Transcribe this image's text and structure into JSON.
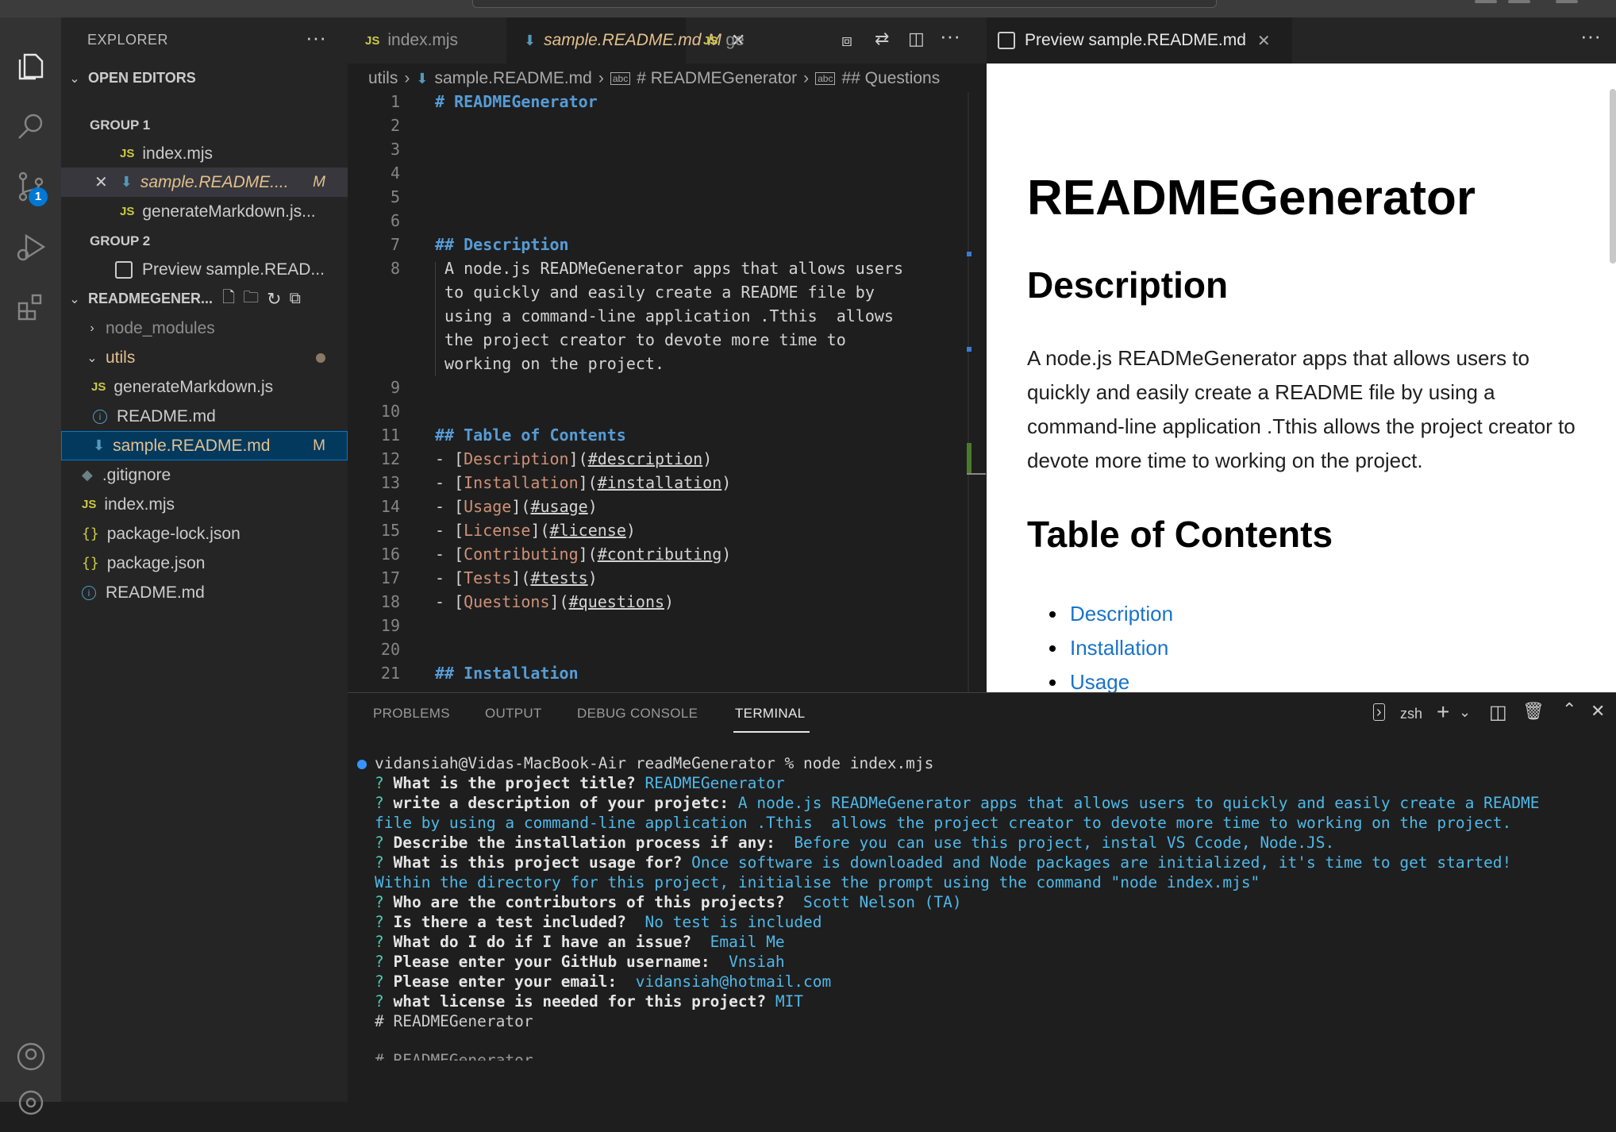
{
  "sidebar": {
    "title": "EXPLORER",
    "open_editors": "OPEN EDITORS",
    "group1": "GROUP 1",
    "group2": "GROUP 2",
    "oe_items": [
      "index.mjs",
      "sample.README....",
      "generateMarkdown.js...",
      "Preview sample.READ..."
    ],
    "mflag": "M",
    "project": "READMEGENER...",
    "tree": [
      "node_modules",
      "utils",
      "generateMarkdown.js",
      "README.md",
      "sample.README.md",
      ".gitignore",
      "index.mjs",
      "package-lock.json",
      "package.json",
      "README.md"
    ],
    "scm_badge": "1"
  },
  "editor": {
    "tabs": [
      "index.mjs",
      "sample.README.md",
      "M",
      "ge"
    ],
    "crumbs": [
      "utils",
      "sample.README.md",
      "# READMEGenerator",
      "## Questions"
    ],
    "lines": [
      {
        "n": "1",
        "t": "# READMEGenerator"
      },
      {
        "n": "2",
        "t": ""
      },
      {
        "n": "3",
        "t": ""
      },
      {
        "n": "4",
        "t": ""
      },
      {
        "n": "5",
        "t": ""
      },
      {
        "n": "6",
        "t": ""
      },
      {
        "n": "7",
        "t": "## Description"
      },
      {
        "n": "8",
        "t": " A node.js READMeGenerator apps that allows users"
      },
      {
        "n": "",
        "t": " to quickly and easily create a README file by"
      },
      {
        "n": "",
        "t": " using a command-line application .Tthis  allows"
      },
      {
        "n": "",
        "t": " the project creator to devote more time to"
      },
      {
        "n": "",
        "t": " working on the project."
      },
      {
        "n": "9",
        "t": ""
      },
      {
        "n": "10",
        "t": ""
      },
      {
        "n": "11",
        "t": "## Table of Contents"
      },
      {
        "n": "12",
        "t": "- [Description](#description)"
      },
      {
        "n": "13",
        "t": "- [Installation](#installation)"
      },
      {
        "n": "14",
        "t": "- [Usage](#usage)"
      },
      {
        "n": "15",
        "t": "- [License](#license)"
      },
      {
        "n": "16",
        "t": "- [Contributing](#contributing)"
      },
      {
        "n": "17",
        "t": "- [Tests](#tests)"
      },
      {
        "n": "18",
        "t": "- [Questions](#questions)"
      },
      {
        "n": "19",
        "t": ""
      },
      {
        "n": "20",
        "t": ""
      },
      {
        "n": "21",
        "t": "## Installation"
      }
    ]
  },
  "preview": {
    "tab": "Preview sample.README.md",
    "h1": "READMEGenerator",
    "h2_desc": "Description",
    "desc": "A node.js READMeGenerator apps that allows users to quickly and easily create a README file by using a command-line application .Tthis allows the project creator to devote more time to working on the project.",
    "h2_toc": "Table of Contents",
    "toc": [
      "Description",
      "Installation",
      "Usage"
    ]
  },
  "panel": {
    "tabs": [
      "PROBLEMS",
      "OUTPUT",
      "DEBUG CONSOLE",
      "TERMINAL"
    ],
    "shell": "zsh",
    "prompt": "vidansiah@Vidas-MacBook-Air readMeGenerator % node index.mjs",
    "qa": [
      {
        "q": "What is the project title?",
        "a": "READMEGenerator"
      },
      {
        "q": "write a description of your projetc:",
        "a": "A node.js READMeGenerator apps that allows users to quickly and easily create a README"
      },
      {
        "q": "",
        "a": "file by using a command-line application .Tthis  allows the project creator to devote more time to working on the project."
      },
      {
        "q": "Describe the installation process if any:",
        "a": " Before you can use this project, instal VS Ccode, Node.JS."
      },
      {
        "q": "What is this project usage for?",
        "a": "Once software is downloaded and Node packages are initialized, it's time to get started!"
      },
      {
        "q": "",
        "a": "Within the directory for this project, initialise the prompt using the command \"node index.mjs\""
      },
      {
        "q": "Who are the contributors of this projects?",
        "a": " Scott Nelson (TA)"
      },
      {
        "q": "Is there a test included?",
        "a": " No test is included"
      },
      {
        "q": "What do I do if I have an issue?",
        "a": " Email Me"
      },
      {
        "q": "Please enter your GitHub username:",
        "a": " Vnsiah"
      },
      {
        "q": "Please enter your email:",
        "a": " vidansiah@hotmail.com"
      },
      {
        "q": "what license is needed for this project?",
        "a": "MIT"
      }
    ],
    "out1": "# READMEGenerator",
    "out2": "# READMEGenerator"
  }
}
